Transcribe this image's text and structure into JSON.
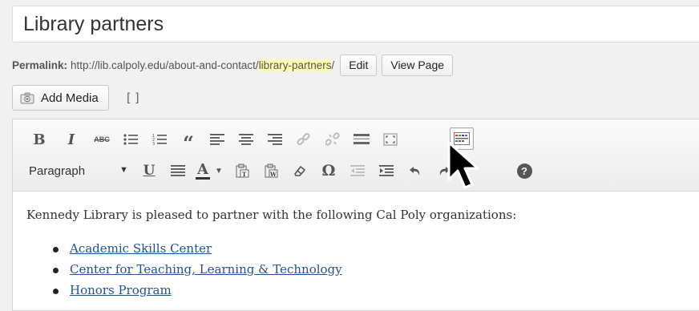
{
  "post_title": "Library partners",
  "permalink": {
    "label": "Permalink:",
    "base_url": "http://lib.calpoly.edu/about-and-contact/",
    "slug": "library-partners",
    "trailing": "/"
  },
  "buttons": {
    "edit": "Edit",
    "view_page": "View Page",
    "add_media": "Add Media"
  },
  "toolbar": {
    "row1": [
      "bold-icon",
      "italic-icon",
      "strikethrough-icon",
      "bullet-list-icon",
      "numbered-list-icon",
      "blockquote-icon",
      "align-left-icon",
      "align-center-icon",
      "align-right-icon",
      "insert-link-icon",
      "remove-link-icon",
      "read-more-icon",
      "fullscreen-icon",
      "toolbar-toggle-icon"
    ],
    "row2": [
      "format-select",
      "underline-icon",
      "justify-icon",
      "text-color-icon",
      "paste-text-icon",
      "paste-word-icon",
      "clear-formatting-icon",
      "special-character-icon",
      "outdent-icon",
      "indent-icon",
      "undo-icon",
      "redo-icon",
      "help-icon"
    ],
    "format_value": "Paragraph",
    "bold_glyph": "B",
    "italic_glyph": "I",
    "strike_glyph": "ABC",
    "quote_glyph": "“",
    "underline_glyph": "U",
    "text_color_glyph": "A",
    "omega_glyph": "Ω",
    "help_glyph": "?"
  },
  "content": {
    "intro": "Kennedy Library is pleased to partner with the following Cal Poly organizations:",
    "links": [
      "Academic Skills Center",
      "Center for Teaching, Learning & Technology",
      "Honors Program"
    ]
  },
  "colors": {
    "link": "#21538f",
    "slug_highlight": "#fffbb0"
  }
}
